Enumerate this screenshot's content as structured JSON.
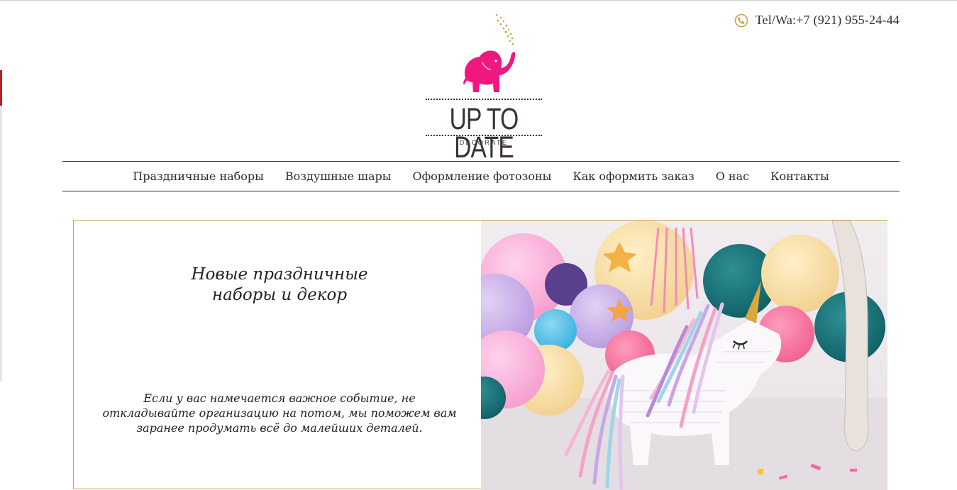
{
  "header": {
    "phone": "Tel/Wa:+7 (921) 955-24-44",
    "logo": {
      "word": "UP TO DATE",
      "sub": "DECORATE"
    }
  },
  "nav": {
    "items": [
      {
        "label": "Праздничные наборы"
      },
      {
        "label": "Воздушные шары"
      },
      {
        "label": "Оформление фотозоны"
      },
      {
        "label": "Как оформить заказ"
      },
      {
        "label": "О нас"
      },
      {
        "label": "Контакты"
      }
    ]
  },
  "hero": {
    "title_line1": "Новые праздничные",
    "title_line2": "наборы и декор",
    "description": "Если у вас намечается важное событие, не откладывайте организацию на потом, мы поможем вам заранее продумать всё до малейших деталей."
  },
  "colors": {
    "elephant": "#f0177f",
    "confetti": "#c9a43f",
    "border": "#c9a54a",
    "text": "#2b2b2b"
  },
  "icons": {
    "phone": "phone-icon",
    "logo": "elephant-logo"
  }
}
